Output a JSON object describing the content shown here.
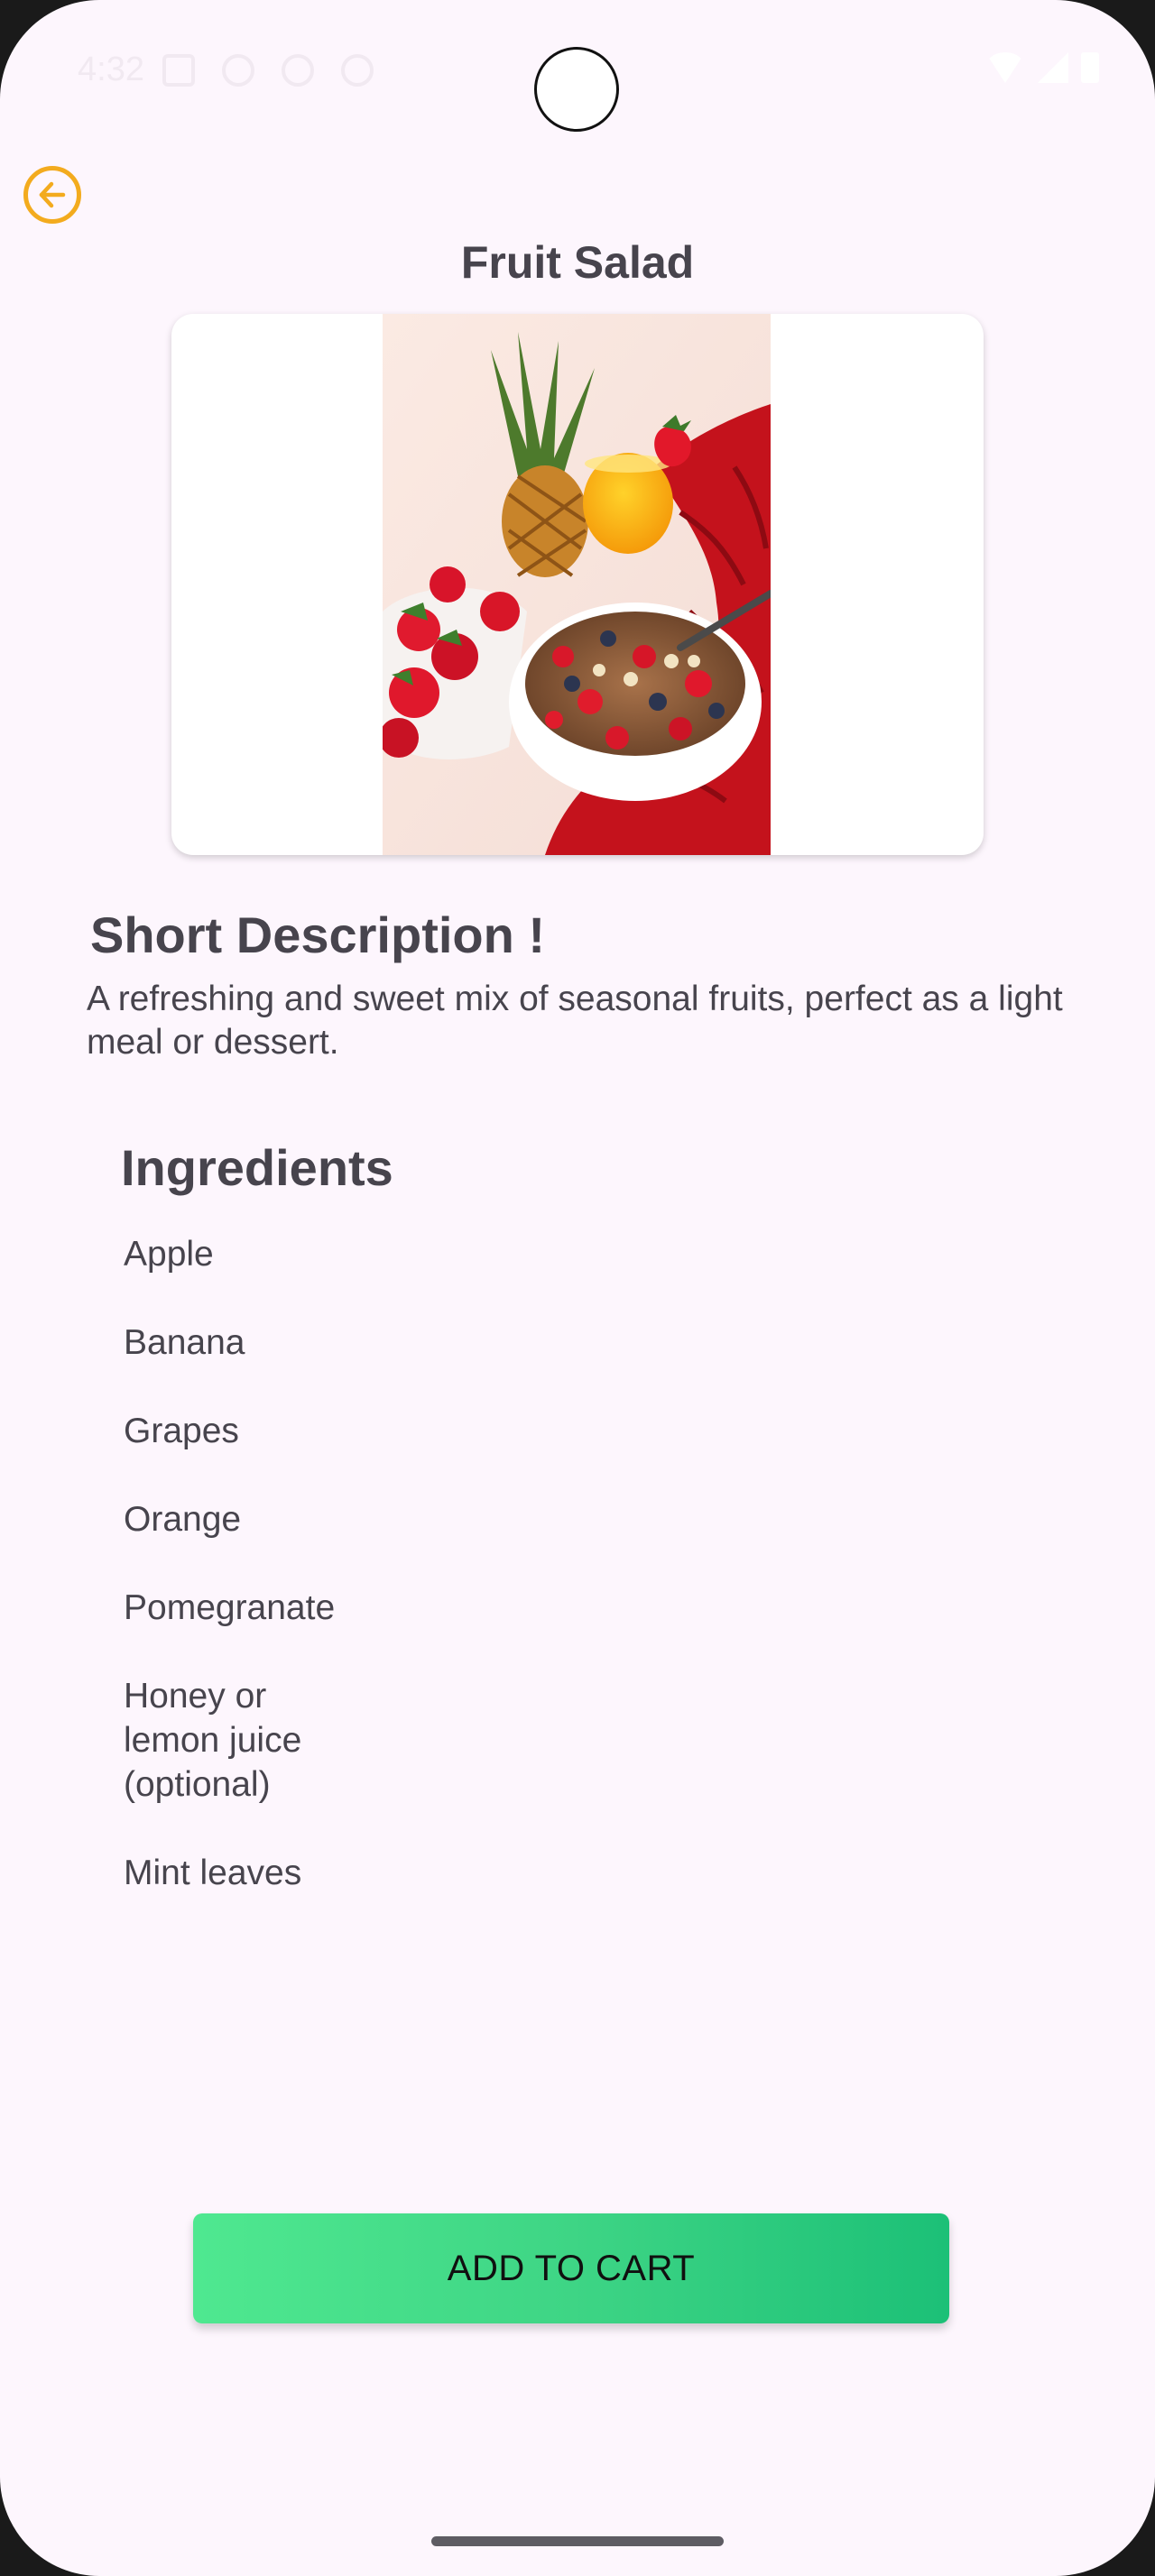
{
  "status_bar": {
    "time": "4:32"
  },
  "header": {
    "title": "Fruit Salad",
    "back_icon": "arrow-left-circle-icon"
  },
  "image": {
    "alt": "Bowl of cereal with strawberries, pineapple and orange juice"
  },
  "description": {
    "heading": "Short Description !",
    "text": "A refreshing and sweet mix of seasonal fruits, perfect as a light meal or dessert."
  },
  "ingredients": {
    "heading": "Ingredients",
    "items": [
      "Apple",
      "Banana",
      "Grapes",
      "Orange",
      "Pomegranate",
      "Honey or lemon juice (optional)",
      "Mint leaves"
    ]
  },
  "actions": {
    "add_to_cart_label": "ADD TO CART"
  },
  "colors": {
    "background": "#fdf6fd",
    "back_icon": "#f3ab1e",
    "button_gradient_start": "#4fe890",
    "button_gradient_end": "#1cc077",
    "text": "#47444d"
  }
}
